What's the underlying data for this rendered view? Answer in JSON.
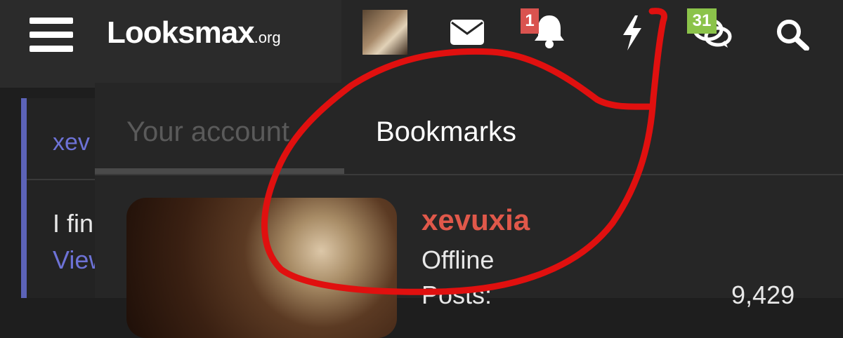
{
  "header": {
    "logo_main": "Looksmax",
    "logo_tld": ".org",
    "nav_icons": {
      "menu": "menu-icon",
      "avatar": "avatar",
      "inbox": "envelope-icon",
      "alerts": "bell-icon",
      "whats_new": "lightning-icon",
      "chat": "chat-bubbles-icon",
      "search": "search-icon"
    },
    "alerts_badge": "1",
    "chat_badge": "31"
  },
  "dropdown": {
    "tabs": [
      {
        "label": "Your account"
      },
      {
        "label": "Bookmarks"
      }
    ],
    "profile": {
      "username": "xevuxia",
      "status": "Offline",
      "posts_label": "Posts:",
      "posts_value": "9,429"
    }
  },
  "background_post": {
    "username": "xev",
    "text": "I fin",
    "link": "View"
  },
  "colors": {
    "header_bg": "#262626",
    "username": "#e0584a",
    "badge_red": "#d9534f",
    "badge_green": "#8bc34a",
    "link": "#6d72d6",
    "annotation": "#e0100f",
    "inactive_tab": "#5a5a5a"
  }
}
